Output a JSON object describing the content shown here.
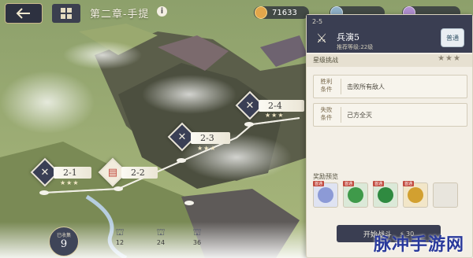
{
  "header": {
    "chapter_title": "第二章-手提",
    "info_icon": "info-icon",
    "currencies": [
      {
        "icon": "coin-icon",
        "value": "71633"
      },
      {
        "icon": "stamina-icon",
        "value": ""
      },
      {
        "icon": "gem-icon",
        "value": ""
      }
    ]
  },
  "stages": [
    {
      "id": "2-1",
      "stars": "★★★"
    },
    {
      "id": "2-2",
      "stars": ""
    },
    {
      "id": "2-3",
      "stars": "★★★"
    },
    {
      "id": "2-4",
      "stars": "★★★"
    }
  ],
  "panel": {
    "stage_code": "2-5",
    "stage_name": "兵演5",
    "recommended_level": "推荐等级:22级",
    "difficulty_button": "普通",
    "star_challenge_title": "星级挑战",
    "star_rating": "★★★",
    "victory": {
      "label": "胜利\n条件",
      "text": "击败所有敌人"
    },
    "defeat": {
      "label": "失败\n条件",
      "text": "己方全灭"
    },
    "rewards_title": "奖励预览",
    "rewards": [
      {
        "tag": "首通",
        "color": "#8c9ad6"
      },
      {
        "tag": "首通",
        "color": "#3f9a4a"
      },
      {
        "tag": "首通",
        "color": "#2f8a40"
      },
      {
        "tag": "首通",
        "color": "#d2a030"
      }
    ],
    "start_button": "开始战斗",
    "start_cost": "30"
  },
  "progress": {
    "collected_label": "已收集",
    "collected_value": "9",
    "milestones": [
      "12",
      "24",
      "36"
    ]
  },
  "watermark": "脉冲手游网",
  "colors": {
    "panel_header": "#3a3e52",
    "accent_gold": "#e2a64b"
  }
}
